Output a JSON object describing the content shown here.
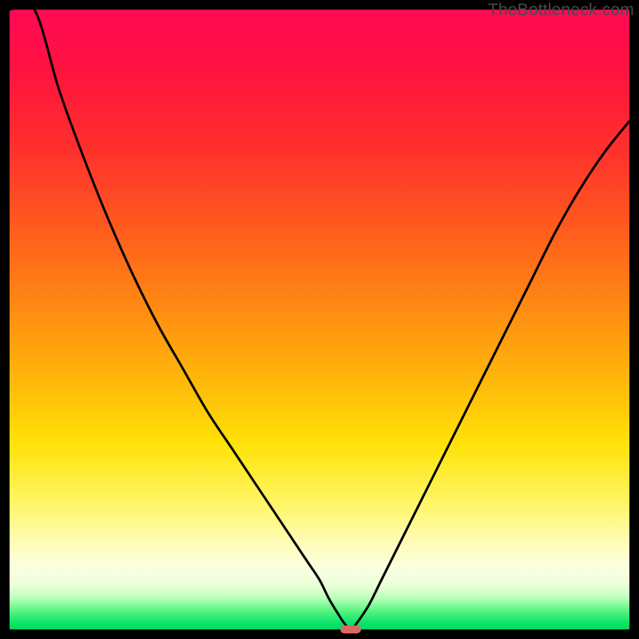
{
  "brand": "TheBottleneck.com",
  "colors": {
    "curve_stroke": "#000000",
    "marker_fill": "#d86a5e",
    "frame_bg": "#000000"
  },
  "chart_data": {
    "type": "line",
    "title": "",
    "xlabel": "",
    "ylabel": "",
    "xlim": [
      0,
      100
    ],
    "ylim": [
      0,
      100
    ],
    "grid": false,
    "legend": false,
    "series": [
      {
        "name": "bottleneck-curve",
        "x": [
          0,
          4,
          8,
          12,
          16,
          20,
          24,
          28,
          32,
          36,
          40,
          44,
          46,
          48,
          50,
          51.5,
          53,
          54,
          55,
          56,
          58,
          60,
          64,
          68,
          72,
          76,
          80,
          84,
          88,
          92,
          96,
          100
        ],
        "y": [
          115,
          100,
          87,
          76,
          66,
          57,
          49,
          42,
          35,
          29,
          23,
          17,
          14,
          11,
          8,
          5,
          2.5,
          1,
          0,
          1,
          4,
          8,
          16,
          24,
          32,
          40,
          48,
          56,
          64,
          71,
          77,
          82
        ]
      }
    ],
    "minimum_point": {
      "x": 55,
      "y": 0
    },
    "annotations": [
      {
        "text": "TheBottleneck.com",
        "role": "watermark",
        "position": "top-right"
      }
    ]
  }
}
